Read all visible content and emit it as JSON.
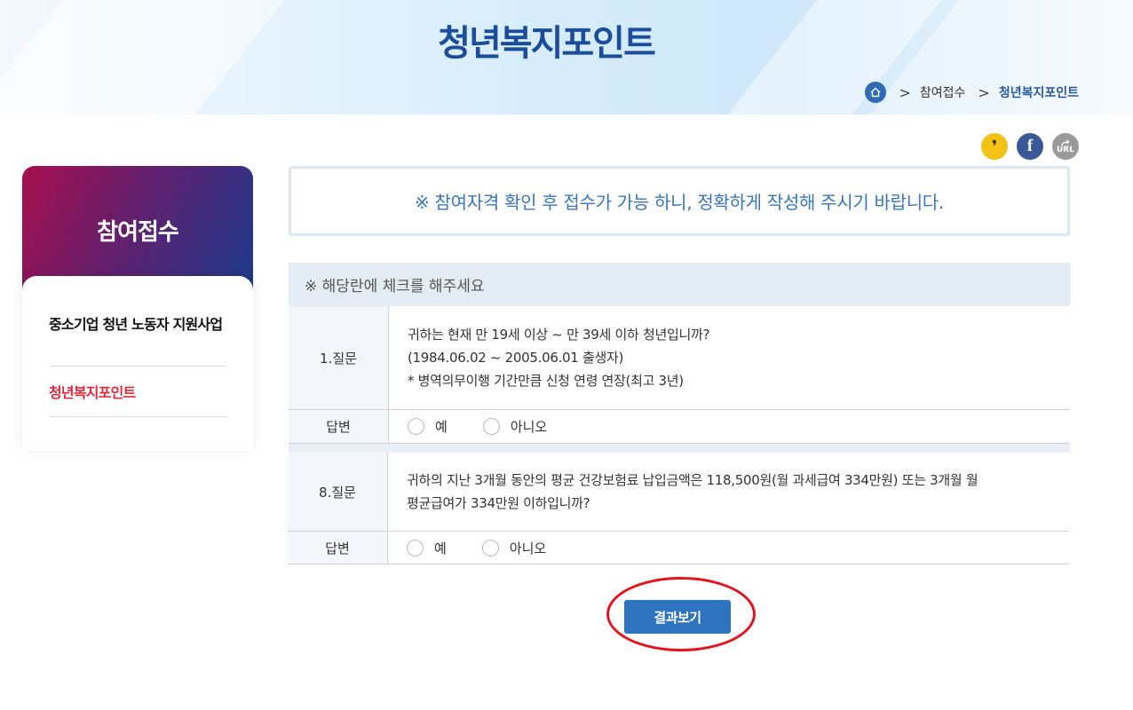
{
  "header": {
    "title": "청년복지포인트",
    "breadcrumb": {
      "separator": ">",
      "items": [
        "참여접수",
        "청년복지포인트"
      ]
    }
  },
  "share": {
    "kakao_label": "❜",
    "facebook_label": "f",
    "url_label": "URL"
  },
  "sidebar": {
    "title": "참여접수",
    "items": [
      {
        "label": "중소기업 청년 노동자 지원사업",
        "active": false
      },
      {
        "label": "청년복지포인트",
        "active": true
      }
    ]
  },
  "notice": "※ 참여자격 확인 후 접수가 가능 하니, 정확하게 작성해 주시기 바랍니다.",
  "check_header": "※ 해당란에 체크를 해주세요",
  "questions": [
    {
      "label": "1.질문",
      "lines": [
        "귀하는 현재 만 19세 이상 ~ 만 39세 이하 청년입니까?",
        "(1984.06.02 ~ 2005.06.01 출생자)",
        "* 병역의무이행 기간만큼 신청 연령 연장(최고 3년)"
      ],
      "answer_label": "답변",
      "options": [
        "예",
        "아니오"
      ]
    },
    {
      "label": "8.질문",
      "lines": [
        "귀하의 지난 3개월 동안의 평균 건강보험료 납입금액은 118,500원(월 과세급여 334만원) 또는 3개월 월",
        "평균급여가 334만원 이하입니까?"
      ],
      "answer_label": "답변",
      "options": [
        "예",
        "아니오"
      ]
    }
  ],
  "result_button": "결과보기",
  "colors": {
    "brand_blue": "#2e73bd",
    "title_blue": "#1a4d9c",
    "active_red": "#e0293b",
    "highlight_red": "#e2141e"
  }
}
